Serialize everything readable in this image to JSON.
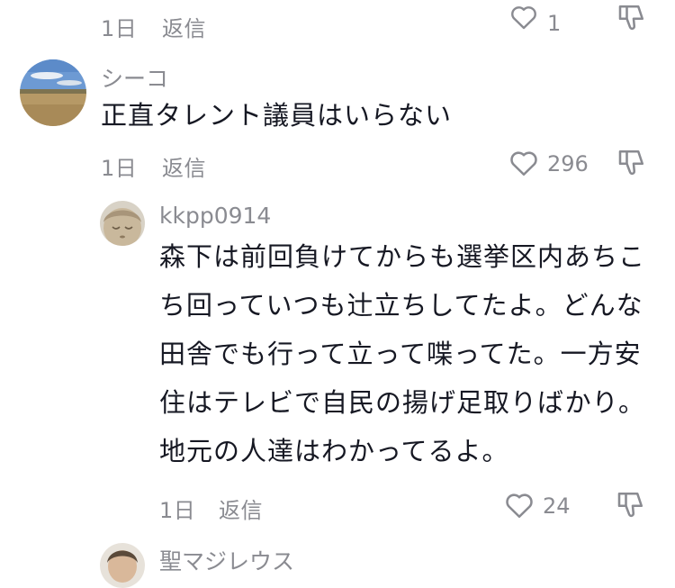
{
  "top_partial": {
    "date": "1日",
    "reply_label": "返信",
    "like_count": "1"
  },
  "comments": [
    {
      "username": "シーコ",
      "text": "正直タレント議員はいらない",
      "date": "1日",
      "reply_label": "返信",
      "like_count": "296"
    }
  ],
  "reply": {
    "username": "kkpp0914",
    "lines": [
      "森下は前回負けてからも選挙区内あちこ",
      "ち回っていつも辻立ちしてたよ。どんな",
      "田舎でも行って立って喋ってた。一方安",
      "住はテレビで自民の揚げ足取りばかり。",
      "地元の人達はわかってるよ。"
    ],
    "date": "1日",
    "reply_label": "返信",
    "like_count": "24"
  },
  "bottom_partial": {
    "username": "聖マジレウス"
  },
  "icons": {
    "like": "heart-outline-icon",
    "dislike": "thumbs-down-icon"
  },
  "colors": {
    "text": "#161823",
    "muted": "#8a8b91"
  }
}
